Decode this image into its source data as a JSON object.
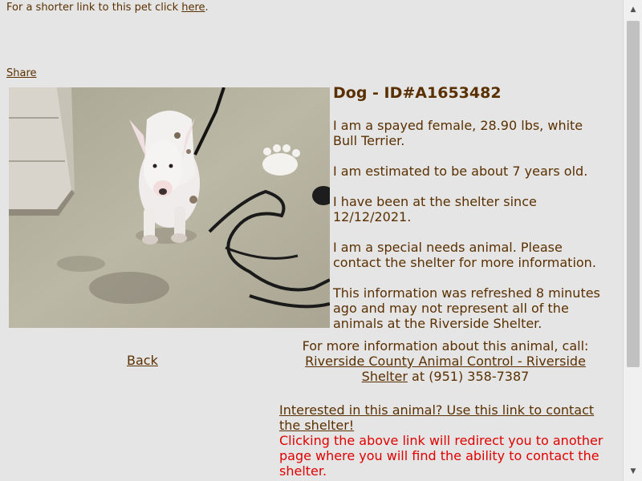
{
  "shortlink": {
    "prefix": "For a shorter link to this pet click ",
    "link_text": "here",
    "suffix": "."
  },
  "share_label": "Share",
  "pet": {
    "title": "Dog - ID#A1653482",
    "description": "I am a spayed female, 28.90 lbs, white Bull Terrier.",
    "age": "I am estimated to be about 7 years old.",
    "since": "I have been at the shelter since 12/12/2021.",
    "special_needs": "I am a special needs animal. Please contact the shelter for more information.",
    "refresh_note": "This information was refreshed 8 minutes ago and may not represent all of the animals at the Riverside Shelter."
  },
  "back_label": "Back",
  "contact": {
    "intro": "For more information about this animal, call:",
    "shelter_name": "Riverside County Animal Control - Riverside Shelter",
    "phone_text": " at (951) 358-7387"
  },
  "interested_link": "Interested in this animal? Use this link to contact the shelter!",
  "redirect_note": "Clicking the above link will redirect you to another page where you will find the ability to contact the shelter.",
  "scrollbar": {
    "up_icon": "▲",
    "down_icon": "▼"
  }
}
